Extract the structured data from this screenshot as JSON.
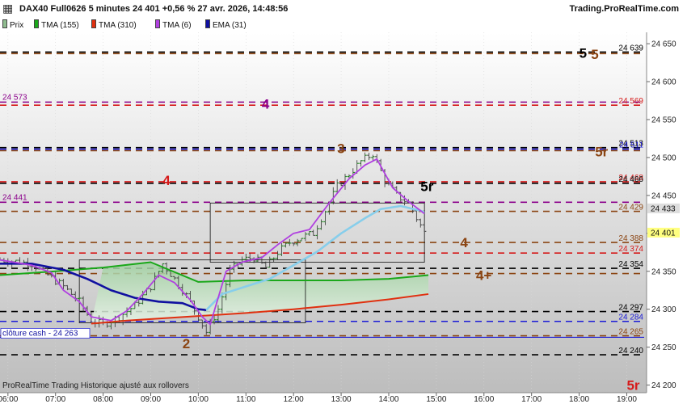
{
  "header": {
    "title": "DAX40 Full0626 5 minutes 24 401 +0,56 % 27 avr. 2026, 14:48:56",
    "site": "Trading.ProRealTime.com"
  },
  "legend": [
    {
      "label": "Prix",
      "color": "#8fbc8f"
    },
    {
      "label": "TMA (155)",
      "color": "#1aa81a"
    },
    {
      "label": "TMA (310)",
      "color": "#e03010"
    },
    {
      "label": "TMA (6)",
      "color": "#b040e0"
    },
    {
      "label": "EMA (31)",
      "color": "#1010a0"
    }
  ],
  "footer": "ProRealTime Trading  Historique ajusté aux rollovers",
  "chart_data": {
    "type": "candlestick",
    "x_ticks": [
      "06:00",
      "07:00",
      "08:00",
      "09:00",
      "10:00",
      "11:00",
      "12:00",
      "13:00",
      "14:00",
      "15:00",
      "16:00",
      "17:00",
      "18:00",
      "19:00"
    ],
    "x_range": [
      "05:50",
      "19:25"
    ],
    "y_ticks": [
      24200,
      24250,
      24300,
      24350,
      24400,
      24450,
      24500,
      24550,
      24600,
      24650
    ],
    "y_range": [
      24190,
      24665
    ],
    "levels": [
      {
        "value": 24639,
        "label": "24 639",
        "color": "#000000",
        "style": "dash"
      },
      {
        "value": 24637,
        "label": "",
        "color": "#8b4513",
        "style": "dash"
      },
      {
        "value": 24573,
        "label": "24 573",
        "color": "#8b008b",
        "style": "dash-left"
      },
      {
        "value": 24569,
        "label": "24 569",
        "color": "#d61a1a",
        "style": "dash"
      },
      {
        "value": 24513,
        "label": "24 513",
        "color": "#000000",
        "style": "dash"
      },
      {
        "value": 24511,
        "label": "24 511",
        "color": "#1a1ad6",
        "style": "dash"
      },
      {
        "value": 24509,
        "label": "",
        "color": "#8b4513",
        "style": "dash"
      },
      {
        "value": 24468,
        "label": "24 468",
        "color": "#d61a1a",
        "style": "dash"
      },
      {
        "value": 24466,
        "label": "24 466",
        "color": "#000000",
        "style": "dash"
      },
      {
        "value": 24441,
        "label": "24 441",
        "color": "#8b008b",
        "style": "dash-left"
      },
      {
        "value": 24429,
        "label": "24 429",
        "color": "#8b4513",
        "style": "dash"
      },
      {
        "value": 24388,
        "label": "24 388",
        "color": "#8b4513",
        "style": "dash"
      },
      {
        "value": 24374,
        "label": "24 374",
        "color": "#d61a1a",
        "style": "dash"
      },
      {
        "value": 24354,
        "label": "24 354",
        "color": "#000000",
        "style": "dash"
      },
      {
        "value": 24347,
        "label": "",
        "color": "#8b4513",
        "style": "dash"
      },
      {
        "value": 24297,
        "label": "24 297",
        "color": "#000000",
        "style": "dash"
      },
      {
        "value": 24284,
        "label": "24 284",
        "color": "#1a1ad6",
        "style": "dash"
      },
      {
        "value": 24265,
        "label": "24 265",
        "color": "#8b4513",
        "style": "dash"
      },
      {
        "value": 24263,
        "label": "",
        "color": "#1a1ad6",
        "style": "solid"
      },
      {
        "value": 24240,
        "label": "24 240",
        "color": "#000000",
        "style": "dash"
      }
    ],
    "close_cash": {
      "label": "clôture cash - ",
      "value_label": "24 263",
      "value": 24263
    },
    "last_price": {
      "value": 24401,
      "label": "24 401"
    },
    "ema_tag": {
      "value": 24433,
      "label": "24 433"
    },
    "level_markers": [
      {
        "text": "5",
        "time": "18:00",
        "value": 24638,
        "color": "#000000"
      },
      {
        "text": "5",
        "time": "18:15",
        "value": 24636,
        "color": "#8b4513"
      },
      {
        "text": "4",
        "time": "11:20",
        "value": 24571,
        "color": "#8b008b"
      },
      {
        "text": "5r",
        "time": "18:20",
        "value": 24508,
        "color": "#8b4513"
      },
      {
        "text": "4",
        "time": "09:15",
        "value": 24470,
        "color": "#d61a1a"
      },
      {
        "text": "5r",
        "time": "14:40",
        "value": 24462,
        "color": "#000000"
      },
      {
        "text": "3",
        "time": "12:55",
        "value": 24512,
        "color": "#8b4513"
      },
      {
        "text": "4",
        "time": "15:30",
        "value": 24388,
        "color": "#8b4513"
      },
      {
        "text": "4+",
        "time": "15:50",
        "value": 24345,
        "color": "#8b4513"
      },
      {
        "text": "2",
        "time": "09:40",
        "value": 24255,
        "color": "#8b4513"
      },
      {
        "text": "5r",
        "time": "19:00",
        "value": 24200,
        "color": "#d61a1a"
      }
    ],
    "boxes": [
      {
        "t0": "07:30",
        "t1": "12:15",
        "high": 24365,
        "low": 24282
      },
      {
        "t0": "10:15",
        "t1": "14:45",
        "high": 24440,
        "low": 24362
      }
    ],
    "series": [
      {
        "name": "TMA (155)",
        "color": "#1aa81a",
        "points": [
          [
            "05:50",
            24345
          ],
          [
            "07:00",
            24350
          ],
          [
            "08:00",
            24355
          ],
          [
            "09:00",
            24362
          ],
          [
            "10:00",
            24336
          ],
          [
            "11:00",
            24338
          ],
          [
            "12:00",
            24338
          ],
          [
            "13:00",
            24338
          ],
          [
            "14:00",
            24340
          ],
          [
            "14:50",
            24345
          ]
        ]
      },
      {
        "name": "TMA (310)",
        "color": "#e03010",
        "points": [
          [
            "07:45",
            24281
          ],
          [
            "08:30",
            24285
          ],
          [
            "09:30",
            24289
          ],
          [
            "10:00",
            24291
          ],
          [
            "11:00",
            24295
          ],
          [
            "12:00",
            24300
          ],
          [
            "13:00",
            24306
          ],
          [
            "14:00",
            24313
          ],
          [
            "14:50",
            24320
          ]
        ]
      },
      {
        "name": "EMA (31)",
        "color": "#1010a0",
        "points": [
          [
            "05:50",
            24360
          ],
          [
            "06:30",
            24360
          ],
          [
            "07:10",
            24352
          ],
          [
            "07:40",
            24340
          ],
          [
            "08:10",
            24325
          ],
          [
            "08:40",
            24315
          ],
          [
            "09:10",
            24310
          ],
          [
            "09:40",
            24308
          ],
          [
            "10:00",
            24300
          ],
          [
            "10:10",
            24299
          ]
        ]
      },
      {
        "name": "EMA (31) cont.",
        "color": "#87ceeb",
        "points": [
          [
            "10:10",
            24299
          ],
          [
            "10:30",
            24320
          ],
          [
            "11:00",
            24330
          ],
          [
            "11:30",
            24340
          ],
          [
            "12:00",
            24358
          ],
          [
            "12:30",
            24376
          ],
          [
            "13:00",
            24400
          ],
          [
            "13:30",
            24420
          ],
          [
            "13:50",
            24432
          ],
          [
            "14:15",
            24436
          ],
          [
            "14:40",
            24430
          ],
          [
            "14:45",
            24428
          ]
        ]
      },
      {
        "name": "TMA (6)",
        "color": "#b040e0",
        "points": [
          [
            "05:50",
            24365
          ],
          [
            "06:30",
            24358
          ],
          [
            "06:55",
            24348
          ],
          [
            "07:10",
            24325
          ],
          [
            "07:30",
            24310
          ],
          [
            "07:45",
            24290
          ],
          [
            "08:10",
            24285
          ],
          [
            "08:30",
            24298
          ],
          [
            "08:50",
            24320
          ],
          [
            "09:10",
            24345
          ],
          [
            "09:30",
            24335
          ],
          [
            "09:50",
            24312
          ],
          [
            "10:05",
            24290
          ],
          [
            "10:15",
            24280
          ],
          [
            "10:35",
            24350
          ],
          [
            "10:55",
            24362
          ],
          [
            "11:20",
            24368
          ],
          [
            "11:40",
            24385
          ],
          [
            "12:00",
            24400
          ],
          [
            "12:20",
            24405
          ],
          [
            "12:45",
            24440
          ],
          [
            "13:10",
            24472
          ],
          [
            "13:30",
            24490
          ],
          [
            "13:45",
            24498
          ],
          [
            "14:05",
            24460
          ],
          [
            "14:25",
            24442
          ],
          [
            "14:40",
            24430
          ],
          [
            "14:45",
            24426
          ]
        ]
      }
    ],
    "candles_path": [
      [
        "05:50",
        24365
      ],
      [
        "06:10",
        24363
      ],
      [
        "06:30",
        24360
      ],
      [
        "06:50",
        24345
      ],
      [
        "07:10",
        24330
      ],
      [
        "07:30",
        24310
      ],
      [
        "07:45",
        24285
      ],
      [
        "08:00",
        24280
      ],
      [
        "08:20",
        24290
      ],
      [
        "08:40",
        24305
      ],
      [
        "09:00",
        24330
      ],
      [
        "09:15",
        24360
      ],
      [
        "09:30",
        24340
      ],
      [
        "09:45",
        24318
      ],
      [
        "10:00",
        24290
      ],
      [
        "10:10",
        24270
      ],
      [
        "10:25",
        24300
      ],
      [
        "10:40",
        24350
      ],
      [
        "10:55",
        24365
      ],
      [
        "11:10",
        24368
      ],
      [
        "11:25",
        24355
      ],
      [
        "11:40",
        24375
      ],
      [
        "11:55",
        24388
      ],
      [
        "12:10",
        24395
      ],
      [
        "12:25",
        24400
      ],
      [
        "12:40",
        24430
      ],
      [
        "12:55",
        24462
      ],
      [
        "13:10",
        24478
      ],
      [
        "13:25",
        24495
      ],
      [
        "13:40",
        24505
      ],
      [
        "13:55",
        24470
      ],
      [
        "14:10",
        24450
      ],
      [
        "14:25",
        24440
      ],
      [
        "14:35",
        24420
      ],
      [
        "14:45",
        24401
      ]
    ]
  }
}
